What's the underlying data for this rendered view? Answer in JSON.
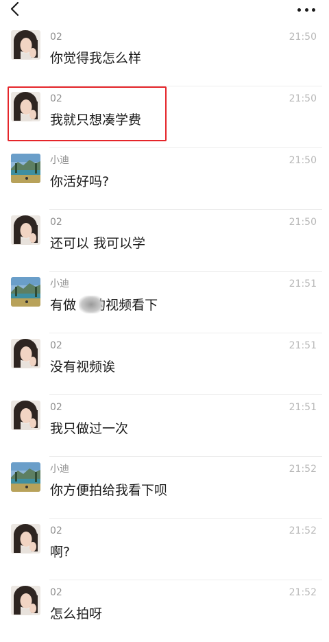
{
  "header": {
    "back_icon": "chevron-left-icon",
    "more_icon": "more-dots-icon"
  },
  "messages": [
    {
      "sender": "02",
      "time": "21:50",
      "text": "你觉得我怎么样",
      "avatar": "woman"
    },
    {
      "sender": "02",
      "time": "21:50",
      "text": "我就只想凑学费",
      "avatar": "woman",
      "highlighted": true
    },
    {
      "sender": "小迪",
      "time": "21:50",
      "text": "你活好吗?",
      "avatar": "landscape"
    },
    {
      "sender": "02",
      "time": "21:50",
      "text": "还可以 我可以学",
      "avatar": "woman"
    },
    {
      "sender": "小迪",
      "time": "21:51",
      "text": "有做    的视频看下",
      "avatar": "landscape"
    },
    {
      "sender": "02",
      "time": "21:51",
      "text": "没有视频诶",
      "avatar": "woman"
    },
    {
      "sender": "02",
      "time": "21:51",
      "text": "我只做过一次",
      "avatar": "woman"
    },
    {
      "sender": "小迪",
      "time": "21:52",
      "text": "你方便拍给我看下呗",
      "avatar": "landscape"
    },
    {
      "sender": "02",
      "time": "21:52",
      "text": "啊?",
      "avatar": "woman"
    },
    {
      "sender": "02",
      "time": "21:52",
      "text": "怎么拍呀",
      "avatar": "woman"
    }
  ],
  "colors": {
    "highlight_border": "#e5252a",
    "time": "#b8b8b8",
    "sender": "#8e8e8e"
  }
}
